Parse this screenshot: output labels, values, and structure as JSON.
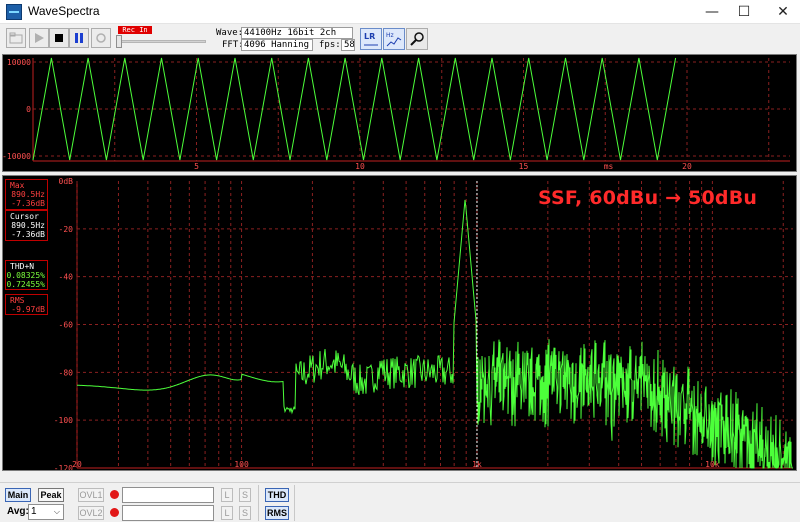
{
  "window": {
    "title": "WaveSpectra",
    "minimize": "—",
    "maximize": "☐",
    "close": "✕"
  },
  "toolbar": {
    "recin_label": "Rec In",
    "wave_label": "Wave:",
    "wave_value": "44100Hz 16bit 2ch",
    "fft_label": "FFT:",
    "fft_value": "4096 Hanning",
    "fps_label": "fps:",
    "fps_value": "58",
    "lr_label": "LR",
    "hz_label": "Hz"
  },
  "wave_panel": {
    "y_ticks": [
      "10000",
      "0",
      "-10000"
    ],
    "x_ticks": [
      "5",
      "10",
      "15",
      "20"
    ],
    "x_unit": "ms"
  },
  "spectrum_panel": {
    "y_ticks": [
      "0dB",
      "-20",
      "-40",
      "-60",
      "-80",
      "-100",
      "-120"
    ],
    "x_ticks": [
      "20",
      "100",
      "1k",
      "10k"
    ],
    "annotation": "SSF, 60dBu → 50dBu",
    "cursor_freq_hz": 1000
  },
  "readouts": {
    "max": {
      "label": "Max",
      "freq": "890.5Hz",
      "level": "-7.36dB"
    },
    "cursor": {
      "label": "Cursor",
      "freq": "890.5Hz",
      "level": "-7.36dB"
    },
    "thd": {
      "label": "THD+N",
      "v1": "0.08325%",
      "v2": "0.72455%"
    },
    "rms": {
      "label": "RMS",
      "v1": "-9.97dB"
    }
  },
  "bottombar": {
    "main_label": "Main",
    "peak_label": "Peak",
    "ovl1_label": "OVL1",
    "ovl2_label": "OVL2",
    "avg_label": "Avg:",
    "avg_value": "1",
    "l_label": "L",
    "s_label": "S",
    "thd_label": "THD",
    "rms_label": "RMS"
  },
  "colors": {
    "trace": "#4cff3a",
    "grid": "#8a2020",
    "axis_text": "#ff5050",
    "annotation": "#ff2a2a"
  }
}
